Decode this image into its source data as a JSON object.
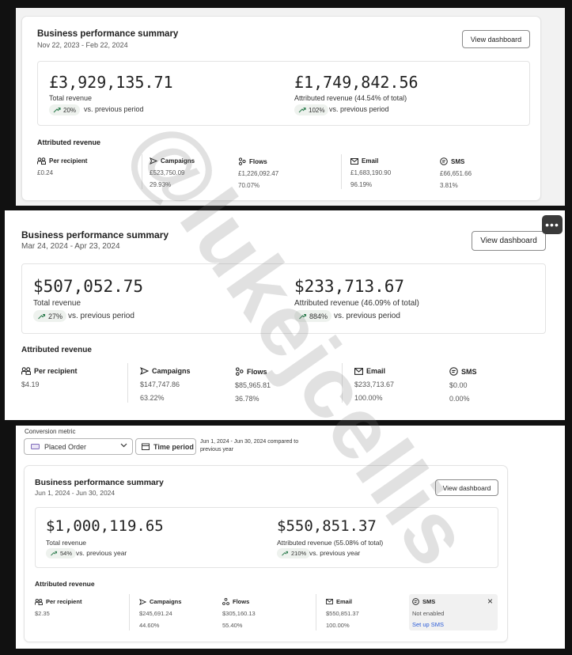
{
  "panel1": {
    "title": "Business performance summary",
    "date_range": "Nov 22, 2023 - Feb 22, 2024",
    "view_button": "View dashboard",
    "total_revenue": "£3,929,135.71",
    "total_revenue_label": "Total revenue",
    "total_change": "20%",
    "total_vs": "vs. previous period",
    "attributed_revenue": "£1,749,842.56",
    "attributed_label": "Attributed revenue",
    "attributed_pct": "(44.54% of total)",
    "attributed_change": "102%",
    "attributed_vs": "vs. previous period",
    "section": "Attributed revenue",
    "columns": [
      {
        "label": "Per recipient",
        "value": "£0.24",
        "pct": ""
      },
      {
        "label": "Campaigns",
        "value": "£523,750.09",
        "pct": "29.93%"
      },
      {
        "label": "Flows",
        "value": "£1,226,092.47",
        "pct": "70.07%"
      },
      {
        "label": "Email",
        "value": "£1,683,190.90",
        "pct": "96.19%"
      },
      {
        "label": "SMS",
        "value": "£66,651.66",
        "pct": "3.81%"
      }
    ]
  },
  "panel2": {
    "title": "Business performance summary",
    "date_range": "Mar 24, 2024 - Apr 23, 2024",
    "view_button": "View dashboard",
    "more_button": "•••",
    "total_revenue": "$507,052.75",
    "total_revenue_label": "Total revenue",
    "total_change": "27%",
    "total_vs": "vs. previous period",
    "attributed_revenue": "$233,713.67",
    "attributed_label": "Attributed revenue",
    "attributed_pct": "(46.09% of total)",
    "attributed_change": "884%",
    "attributed_vs": "vs. previous period",
    "section": "Attributed revenue",
    "columns": [
      {
        "label": "Per recipient",
        "value": "$4.19",
        "pct": ""
      },
      {
        "label": "Campaigns",
        "value": "$147,747.86",
        "pct": "63.22%"
      },
      {
        "label": "Flows",
        "value": "$85,965.81",
        "pct": "36.78%"
      },
      {
        "label": "Email",
        "value": "$233,713.67",
        "pct": "100.00%"
      },
      {
        "label": "SMS",
        "value": "$0.00",
        "pct": "0.00%"
      }
    ]
  },
  "panel3": {
    "conversion_metric_label": "Conversion metric",
    "conversion_metric_value": "Placed Order",
    "time_period_button": "Time period",
    "date_note": "Jun 1, 2024 - Jun 30, 2024 compared to previous year",
    "title": "Business performance summary",
    "date_range": "Jun 1, 2024 - Jun 30, 2024",
    "view_button": "View dashboard",
    "total_revenue": "$1,000,119.65",
    "total_revenue_label": "Total revenue",
    "total_change": "54%",
    "total_vs": "vs. previous year",
    "attributed_revenue": "$550,851.37",
    "attributed_label": "Attributed revenue",
    "attributed_pct": "(55.08% of total)",
    "attributed_change": "210%",
    "attributed_vs": "vs. previous year",
    "section": "Attributed revenue",
    "columns": [
      {
        "label": "Per recipient",
        "value": "$2.35",
        "pct": ""
      },
      {
        "label": "Campaigns",
        "value": "$245,691.24",
        "pct": "44.60%"
      },
      {
        "label": "Flows",
        "value": "$305,160.13",
        "pct": "55.40%"
      },
      {
        "label": "Email",
        "value": "$550,851.37",
        "pct": "100.00%"
      },
      {
        "label": "SMS",
        "value": "Not enabled",
        "pct": "Set up SMS"
      }
    ],
    "sms_close": "×"
  },
  "watermark": "@lukejcellis",
  "colors": {
    "trend_up": "#2e7d4f",
    "pill_bg": "#eef2ee",
    "link": "#2a5bd7"
  }
}
